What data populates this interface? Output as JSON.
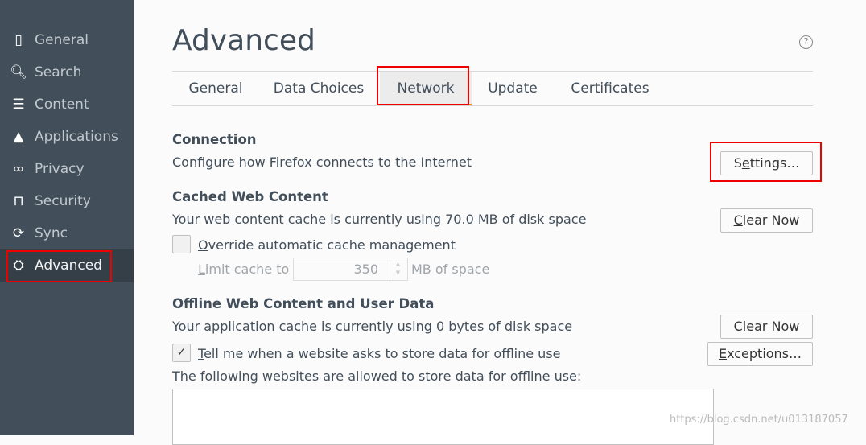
{
  "sidebar": {
    "items": [
      {
        "label": "General",
        "icon": "general-icon"
      },
      {
        "label": "Search",
        "icon": "search-icon"
      },
      {
        "label": "Content",
        "icon": "content-icon"
      },
      {
        "label": "Applications",
        "icon": "applications-icon"
      },
      {
        "label": "Privacy",
        "icon": "privacy-mask-icon"
      },
      {
        "label": "Security",
        "icon": "lock-icon"
      },
      {
        "label": "Sync",
        "icon": "sync-icon"
      },
      {
        "label": "Advanced",
        "icon": "wizard-hat-icon",
        "selected": true
      }
    ]
  },
  "header": {
    "title": "Advanced",
    "help": "?"
  },
  "tabs": [
    {
      "label": "General"
    },
    {
      "label": "Data Choices"
    },
    {
      "label": "Network",
      "selected": true
    },
    {
      "label": "Update"
    },
    {
      "label": "Certificates"
    }
  ],
  "connection": {
    "heading": "Connection",
    "desc": "Configure how Firefox connects to the Internet",
    "settings_pre": "S",
    "settings_u": "e",
    "settings_post": "ttings…"
  },
  "cache": {
    "heading": "Cached Web Content",
    "desc": "Your web content cache is currently using 70.0 MB of disk space",
    "clear_u": "C",
    "clear_post": "lear Now",
    "override_u": "O",
    "override_post": "verride automatic cache management",
    "override_checked": false,
    "limit_u": "L",
    "limit_post": "imit cache to",
    "limit_value": "350",
    "limit_unit": "MB of space"
  },
  "offline": {
    "heading": "Offline Web Content and User Data",
    "desc": "Your application cache is currently using 0 bytes of disk space",
    "clear_pre": "Clear ",
    "clear_u": "N",
    "clear_post": "ow",
    "tell_u": "T",
    "tell_post": "ell me when a website asks to store data for offline use",
    "tell_checked": true,
    "exceptions_u": "E",
    "exceptions_post": "xceptions…",
    "allowed_label": "The following websites are allowed to store data for offline use:"
  },
  "watermark": "https://blog.csdn.net/u013187057",
  "colors": {
    "sidebar": "#424f5a",
    "sidebar_selected": "#343f48",
    "highlight": "#e00000",
    "tab_accent": "#ff9500"
  }
}
